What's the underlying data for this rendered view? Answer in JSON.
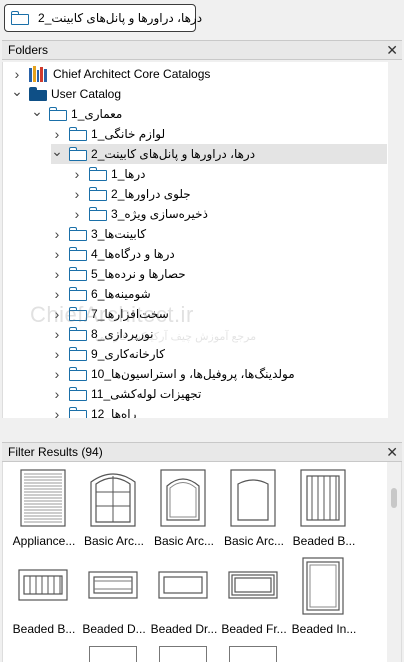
{
  "path_bar": {
    "text": "درها، دراورها و پانل‌های کابینت_2"
  },
  "folders_panel": {
    "title": "Folders",
    "close": "✕",
    "tree": [
      {
        "label": "Chief Architect Core Catalogs",
        "expanded": false,
        "icon": "books-icon",
        "rtl": false
      },
      {
        "label": "User Catalog",
        "expanded": true,
        "icon": "filled-folder-icon",
        "rtl": false
      },
      {
        "label": "معماری_1",
        "expanded": true,
        "icon": "folder-icon",
        "rtl": true
      },
      {
        "label": "لوازم خانگی_1",
        "expanded": false,
        "icon": "folder-icon",
        "rtl": true
      },
      {
        "label": "درها، دراورها و پانل‌های کابینت_2",
        "expanded": true,
        "selected": true,
        "icon": "folder-icon",
        "rtl": true
      },
      {
        "label": "درها_1",
        "expanded": false,
        "icon": "folder-icon",
        "rtl": true
      },
      {
        "label": "جلوی دراورها_2",
        "expanded": false,
        "icon": "folder-icon",
        "rtl": true
      },
      {
        "label": "ذخیره‌سازی ویژه_3",
        "expanded": false,
        "icon": "folder-icon",
        "rtl": true
      },
      {
        "label": "کابینت‌ها_3",
        "expanded": false,
        "icon": "folder-icon",
        "rtl": true
      },
      {
        "label": "درها و درگاه‌ها_4",
        "expanded": false,
        "icon": "folder-icon",
        "rtl": true
      },
      {
        "label": "حصارها و نرده‌ها_5",
        "expanded": false,
        "icon": "folder-icon",
        "rtl": true
      },
      {
        "label": "شومینه‌ها_6",
        "expanded": false,
        "icon": "folder-icon",
        "rtl": true
      },
      {
        "label": "سخت‌افزارها_7",
        "expanded": false,
        "icon": "folder-icon",
        "rtl": true
      },
      {
        "label": "نورپردازی_8",
        "expanded": false,
        "icon": "folder-icon",
        "rtl": true
      },
      {
        "label": "کارخانه‌کاری_9",
        "expanded": false,
        "icon": "folder-icon",
        "rtl": true
      },
      {
        "label": "مولدینگ‌ها، پروفیل‌ها، و استراسیون‌ها_10",
        "expanded": false,
        "icon": "folder-icon",
        "rtl": true
      },
      {
        "label": "تجهیزات لوله‌کشی_11",
        "expanded": false,
        "icon": "folder-icon",
        "rtl": true
      },
      {
        "label": "راه‌ها_12",
        "expanded": false,
        "icon": "folder-icon",
        "rtl": true
      }
    ]
  },
  "watermark": {
    "brand": "ChiefArchitect.ir",
    "sub": "مرجع آموزش چیف آرکیتکت فارسی"
  },
  "filter_panel": {
    "title": "Filter Results (94)",
    "close": "✕",
    "items": [
      {
        "caption": "Appliance...",
        "kind": "shutter"
      },
      {
        "caption": "Basic Arc...",
        "kind": "arch-grid"
      },
      {
        "caption": "Basic Arc...",
        "kind": "arch-panel"
      },
      {
        "caption": "Basic Arc...",
        "kind": "arch-plain"
      },
      {
        "caption": "Beaded B...",
        "kind": "beaded"
      },
      {
        "caption": "Beaded B...",
        "kind": "beaded-drawer"
      },
      {
        "caption": "Beaded D...",
        "kind": "drawer-lines"
      },
      {
        "caption": "Beaded Dr...",
        "kind": "drawer-plain"
      },
      {
        "caption": "Beaded Fr...",
        "kind": "drawer-frame"
      },
      {
        "caption": "Beaded In...",
        "kind": "inset-panel"
      }
    ]
  },
  "colors": {
    "folder_outline": "#1a6fa8",
    "selection": "#e4e4e4"
  }
}
